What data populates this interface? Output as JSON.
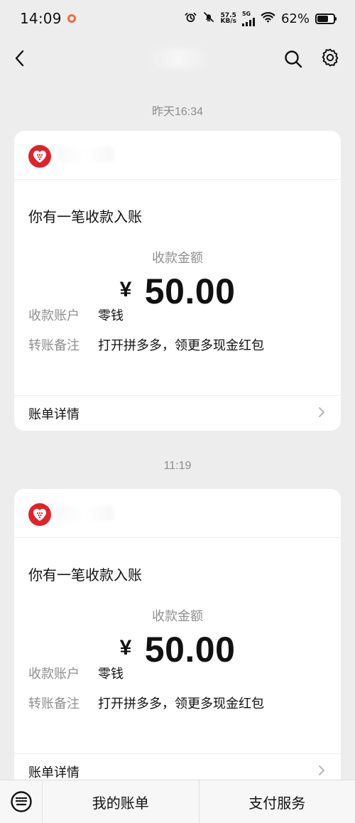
{
  "status_bar": {
    "time": "14:09",
    "speed_value": "57.5",
    "speed_unit": "KB/s",
    "network": "5G",
    "battery": "62%",
    "battery_level": 0.62,
    "indicator_color": "#f06b3c"
  },
  "header": {
    "back_icon": "back-icon",
    "search_icon": "search-icon",
    "settings_icon": "gear-icon"
  },
  "messages": [
    {
      "timestamp": "昨天16:34",
      "merchant_logo": "heart-logo",
      "title": "你有一笔收款入账",
      "amount_label": "收款金额",
      "currency": "¥",
      "amount": "50.00",
      "details": [
        {
          "label": "收款账户",
          "value": "零钱"
        },
        {
          "label": "转账备注",
          "value": "打开拼多多，领更多现金红包"
        }
      ],
      "footer": "账单详情"
    },
    {
      "timestamp": "11:19",
      "merchant_logo": "heart-logo",
      "title": "你有一笔收款入账",
      "amount_label": "收款金额",
      "currency": "¥",
      "amount": "50.00",
      "details": [
        {
          "label": "收款账户",
          "value": "零钱"
        },
        {
          "label": "转账备注",
          "value": "打开拼多多，领更多现金红包"
        }
      ],
      "footer": "账单详情"
    }
  ],
  "bottom_bar": {
    "keyboard_icon": "keyboard-icon",
    "tabs": [
      {
        "label": "我的账单"
      },
      {
        "label": "支付服务"
      }
    ]
  },
  "colors": {
    "background": "#ededed",
    "card": "#ffffff",
    "brand_red": "#e0222a",
    "muted_text": "#8f8f8f"
  }
}
